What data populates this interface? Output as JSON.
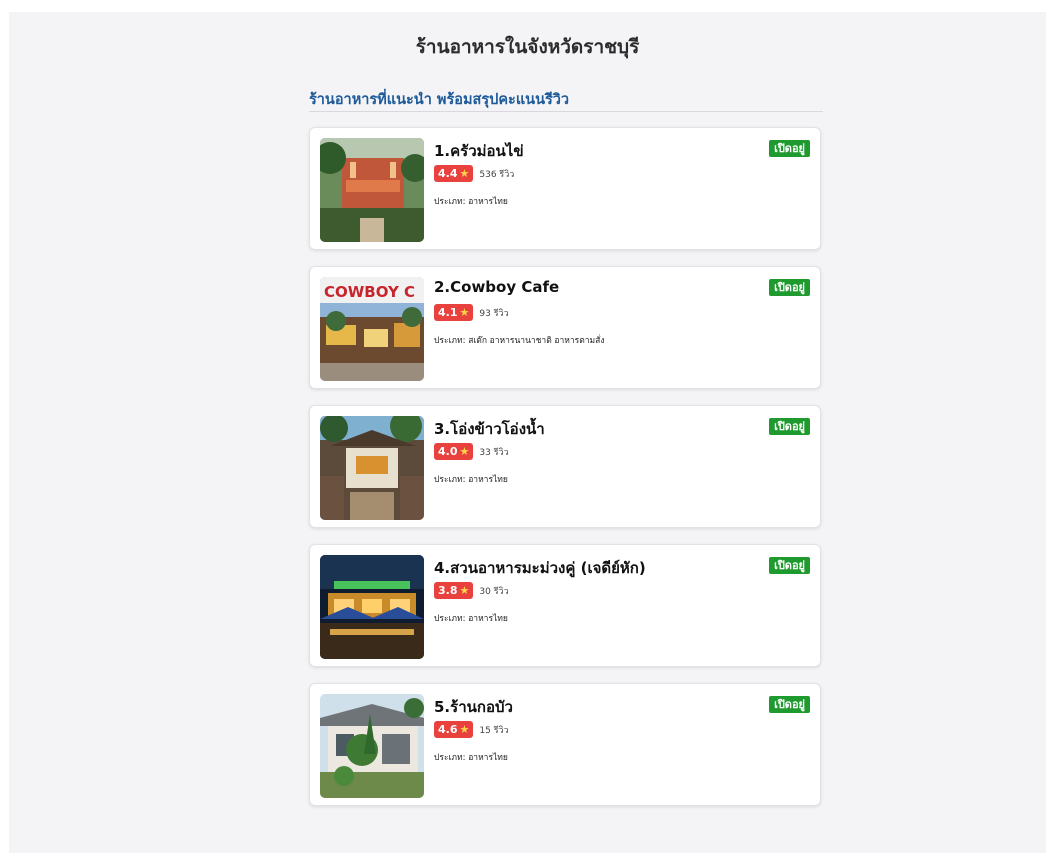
{
  "header": {
    "title": "ร้านอาหารในจังหวัดราชบุรี",
    "subtitle": "ร้านอาหารที่แนะนำ พร้อมสรุปคะแนนรีวิว"
  },
  "restaurants": [
    {
      "name": "1.ครัวม่อนไข่",
      "rating": "4.4",
      "reviews": "536 รีวิว",
      "category": "ประเภท: อาหารไทย",
      "status": "เปิดอยู่",
      "image": "restaurant-garden-photo"
    },
    {
      "name": "2.Cowboy Cafe",
      "rating": "4.1",
      "reviews": "93 รีวิว",
      "category": "ประเภท: สเต๊ก อาหารนานาชาติ อาหารตามสั่ง",
      "status": "เปิดอยู่",
      "image": "cowboy-cafe-sign-photo"
    },
    {
      "name": "3.โอ่งข้าวโอ่งน้ำ",
      "rating": "4.0",
      "reviews": "33 รีวิว",
      "category": "ประเภท: อาหารไทย",
      "status": "เปิดอยู่",
      "image": "restaurant-entrance-photo"
    },
    {
      "name": "4.สวนอาหารมะม่วงคู่ (เจดีย์หัก)",
      "rating": "3.8",
      "reviews": "30 รีวิว",
      "category": "ประเภท: อาหารไทย",
      "status": "เปิดอยู่",
      "image": "night-restaurant-photo"
    },
    {
      "name": "5.ร้านกอบัว",
      "rating": "4.6",
      "reviews": "15 รีวิว",
      "category": "ประเภท: อาหารไทย",
      "status": "เปิดอยู่",
      "image": "house-garden-photo"
    }
  ],
  "colors": {
    "rating_badge": "#e8413e",
    "status_badge": "#1f9a2f",
    "subtitle": "#1f5b9a"
  },
  "icons": {
    "rating": "star-icon"
  }
}
